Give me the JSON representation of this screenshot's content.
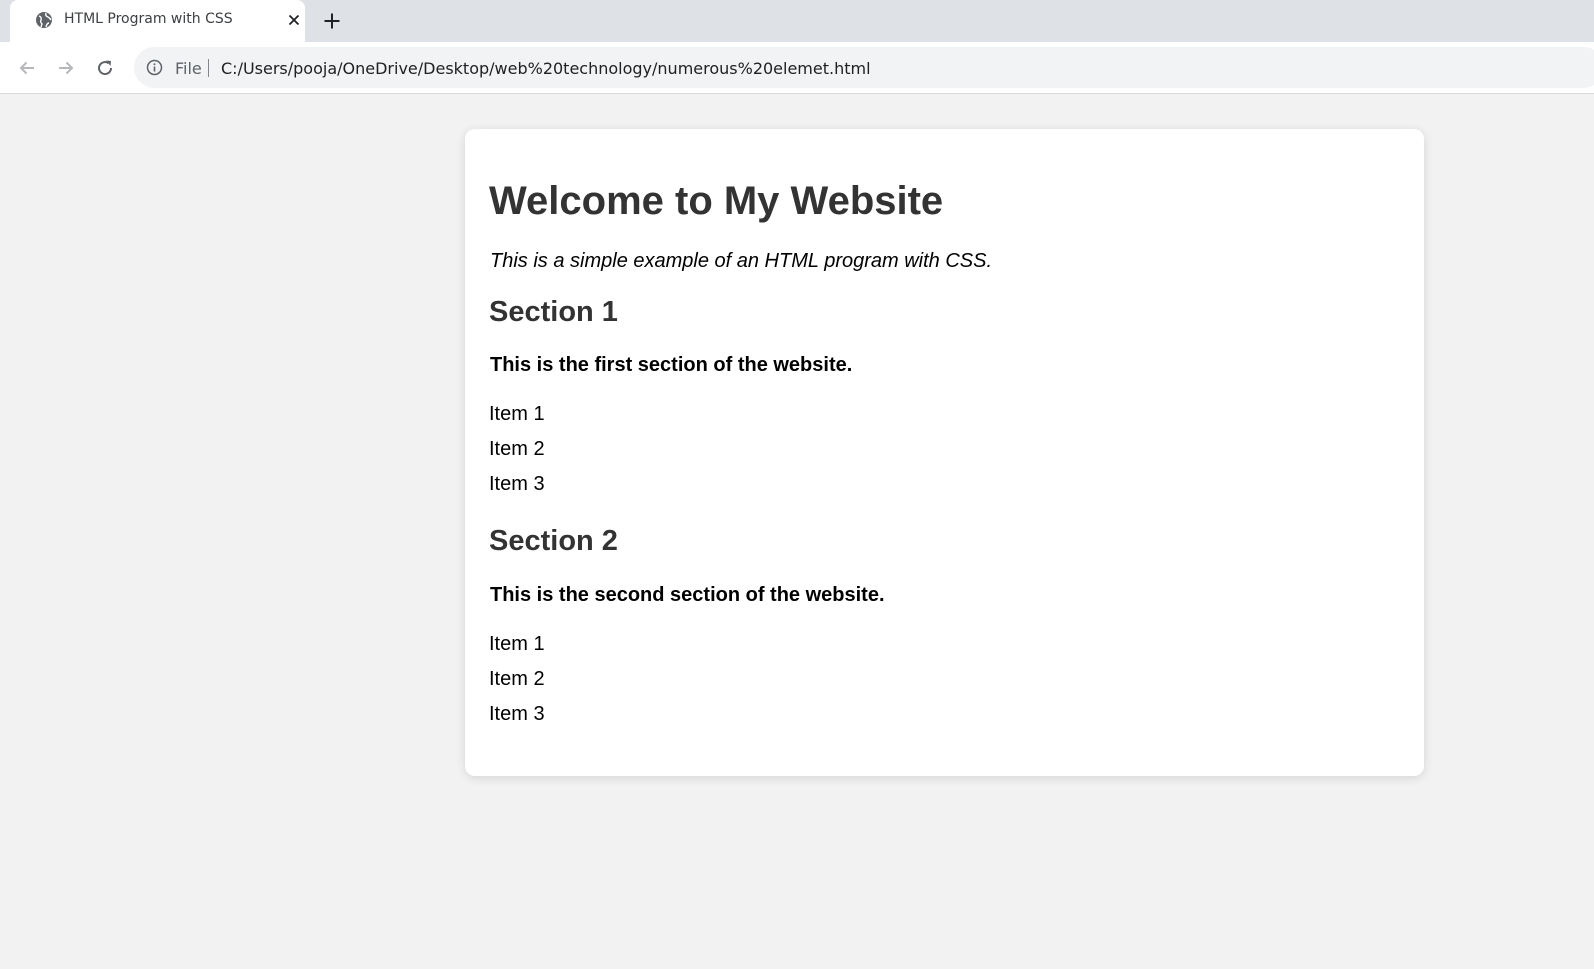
{
  "browser": {
    "tab": {
      "title": "HTML Program with CSS",
      "favicon": "globe-icon",
      "close_icon": "close-icon"
    },
    "new_tab_icon": "plus-icon",
    "nav": {
      "back_icon": "back-arrow-icon",
      "forward_icon": "forward-arrow-icon",
      "reload_icon": "reload-icon"
    },
    "omnibox": {
      "info_icon": "info-icon",
      "scheme_label": "File",
      "url": "C:/Users/pooja/OneDrive/Desktop/web%20technology/numerous%20elemet.html"
    }
  },
  "page": {
    "title": "Welcome to My Website",
    "intro": "This is a simple example of an HTML program with CSS.",
    "sections": [
      {
        "heading": "Section 1",
        "description": "This is the first section of the website.",
        "items": [
          "Item 1",
          "Item 2",
          "Item 3"
        ]
      },
      {
        "heading": "Section 2",
        "description": "This is the second section of the website.",
        "items": [
          "Item 1",
          "Item 2",
          "Item 3"
        ]
      }
    ]
  },
  "colors": {
    "page_background": "#f2f2f2",
    "card_background": "#ffffff",
    "heading_text": "#333333",
    "tabstrip": "#dee1e6"
  }
}
